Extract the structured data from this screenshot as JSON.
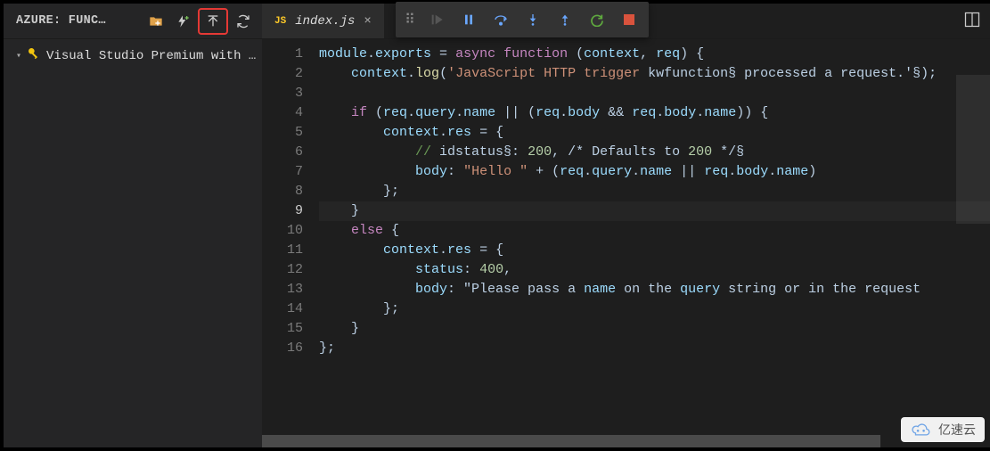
{
  "sidebar": {
    "header_title": "AZURE: FUNC…",
    "icons": {
      "folder": "folder-plus-icon",
      "bolt": "bolt-plus-icon",
      "upload": "upload-icon",
      "refresh": "refresh-icon"
    },
    "tree_item": {
      "label": "Visual Studio Premium with …"
    }
  },
  "tab": {
    "lang_badge": "JS",
    "filename": "index.js",
    "close": "×"
  },
  "debug_toolbar": {
    "grip": "grip-icon",
    "continue": "continue-icon",
    "pause": "pause-icon",
    "step_over": "step-over-icon",
    "step_into": "step-into-icon",
    "step_out": "step-out-icon",
    "restart": "restart-icon",
    "stop": "stop-icon"
  },
  "top_right_icon": "split-editor-icon",
  "code_lines": [
    {
      "n": "1",
      "plain": "module.exports = async function (context, req) {"
    },
    {
      "n": "2",
      "plain": "    context.log('JavaScript HTTP trigger function processed a request.');"
    },
    {
      "n": "3",
      "plain": ""
    },
    {
      "n": "4",
      "plain": "    if (req.query.name || (req.body && req.body.name)) {"
    },
    {
      "n": "5",
      "plain": "        context.res = {"
    },
    {
      "n": "6",
      "plain": "            // status: 200, /* Defaults to 200 */"
    },
    {
      "n": "7",
      "plain": "            body: \"Hello \" + (req.query.name || req.body.name)"
    },
    {
      "n": "8",
      "plain": "        };"
    },
    {
      "n": "9",
      "plain": "    }"
    },
    {
      "n": "10",
      "plain": "    else {"
    },
    {
      "n": "11",
      "plain": "        context.res = {"
    },
    {
      "n": "12",
      "plain": "            status: 400,"
    },
    {
      "n": "13",
      "plain": "            body: \"Please pass a name on the query string or in the request"
    },
    {
      "n": "14",
      "plain": "        };"
    },
    {
      "n": "15",
      "plain": "    }"
    },
    {
      "n": "16",
      "plain": "};"
    }
  ],
  "current_line": 9,
  "watermark": {
    "text": "亿速云"
  }
}
